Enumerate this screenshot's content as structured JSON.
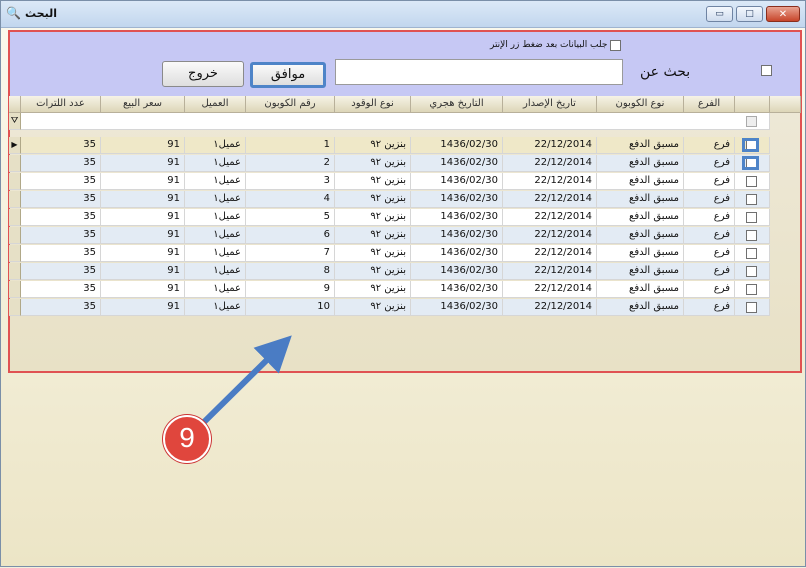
{
  "window": {
    "title": "البحث",
    "min": "▭",
    "max": "□",
    "close": "✕"
  },
  "search": {
    "fetch_label": "جلب البيانات بعد ضغط زر الإنتر",
    "search_label": "بحث عن",
    "query": "",
    "ok_label": "موافق",
    "exit_label": "خروج"
  },
  "grid": {
    "headers": [
      "عدد اللترات",
      "سعر البيع",
      "العميل",
      "رقم الكوبون",
      "نوع الوقود",
      "التاريخ هجري",
      "تاريخ الإصدار",
      "نوع الكوبون",
      "الفرع"
    ],
    "filter_icon": "⛛",
    "rows": [
      {
        "liters": "35",
        "price": "91",
        "client": "عميل١",
        "coupon": "1",
        "fuel": "بنزين ٩٢",
        "hijri": "1436/02/30",
        "issue": "22/12/2014",
        "type": "مسبق الدفع",
        "branch": "فرع"
      },
      {
        "liters": "35",
        "price": "91",
        "client": "عميل١",
        "coupon": "2",
        "fuel": "بنزين ٩٢",
        "hijri": "1436/02/30",
        "issue": "22/12/2014",
        "type": "مسبق الدفع",
        "branch": "فرع"
      },
      {
        "liters": "35",
        "price": "91",
        "client": "عميل١",
        "coupon": "3",
        "fuel": "بنزين ٩٢",
        "hijri": "1436/02/30",
        "issue": "22/12/2014",
        "type": "مسبق الدفع",
        "branch": "فرع"
      },
      {
        "liters": "35",
        "price": "91",
        "client": "عميل١",
        "coupon": "4",
        "fuel": "بنزين ٩٢",
        "hijri": "1436/02/30",
        "issue": "22/12/2014",
        "type": "مسبق الدفع",
        "branch": "فرع"
      },
      {
        "liters": "35",
        "price": "91",
        "client": "عميل١",
        "coupon": "5",
        "fuel": "بنزين ٩٢",
        "hijri": "1436/02/30",
        "issue": "22/12/2014",
        "type": "مسبق الدفع",
        "branch": "فرع"
      },
      {
        "liters": "35",
        "price": "91",
        "client": "عميل١",
        "coupon": "6",
        "fuel": "بنزين ٩٢",
        "hijri": "1436/02/30",
        "issue": "22/12/2014",
        "type": "مسبق الدفع",
        "branch": "فرع"
      },
      {
        "liters": "35",
        "price": "91",
        "client": "عميل١",
        "coupon": "7",
        "fuel": "بنزين ٩٢",
        "hijri": "1436/02/30",
        "issue": "22/12/2014",
        "type": "مسبق الدفع",
        "branch": "فرع"
      },
      {
        "liters": "35",
        "price": "91",
        "client": "عميل١",
        "coupon": "8",
        "fuel": "بنزين ٩٢",
        "hijri": "1436/02/30",
        "issue": "22/12/2014",
        "type": "مسبق الدفع",
        "branch": "فرع"
      },
      {
        "liters": "35",
        "price": "91",
        "client": "عميل١",
        "coupon": "9",
        "fuel": "بنزين ٩٢",
        "hijri": "1436/02/30",
        "issue": "22/12/2014",
        "type": "مسبق الدفع",
        "branch": "فرع"
      },
      {
        "liters": "35",
        "price": "91",
        "client": "عميل١",
        "coupon": "10",
        "fuel": "بنزين ٩٢",
        "hijri": "1436/02/30",
        "issue": "22/12/2014",
        "type": "مسبق الدفع",
        "branch": "فرع"
      }
    ]
  },
  "annotation": {
    "number": "9",
    "arrow_color": "#4a7cc4",
    "badge_color": "#e0463d"
  }
}
